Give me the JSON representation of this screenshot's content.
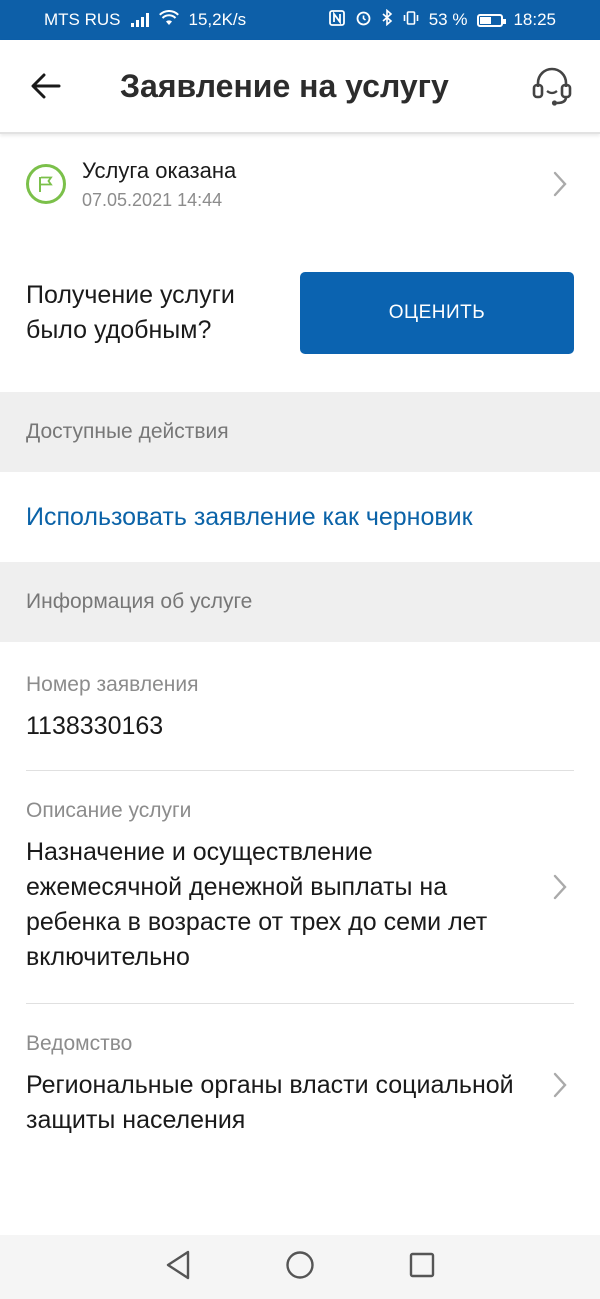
{
  "status_bar": {
    "carrier": "MTS RUS",
    "speed": "15,2K/s",
    "battery": "53 %",
    "time": "18:25"
  },
  "app_bar": {
    "title": "Заявление на услугу"
  },
  "service_status": {
    "title": "Услуга оказана",
    "date": "07.05.2021 14:44"
  },
  "rating": {
    "question": "Получение услуги было удобным?",
    "button_label": "ОЦЕНИТЬ"
  },
  "sections": {
    "actions_header": "Доступные действия",
    "info_header": "Информация об услуге"
  },
  "actions": {
    "use_as_draft": "Использовать заявление как черновик"
  },
  "info": {
    "application_number_label": "Номер заявления",
    "application_number": "1138330163",
    "description_label": "Описание услуги",
    "description": "Назначение и осуществление ежемесячной денежной выплаты на ребенка в возрасте от трех до семи лет включительно",
    "department_label": "Ведомство",
    "department": "Региональные органы власти социальной защиты населения"
  },
  "colors": {
    "brand_blue": "#0b63b0",
    "status_green": "#7bc04a",
    "link_blue": "#0b63a8"
  }
}
